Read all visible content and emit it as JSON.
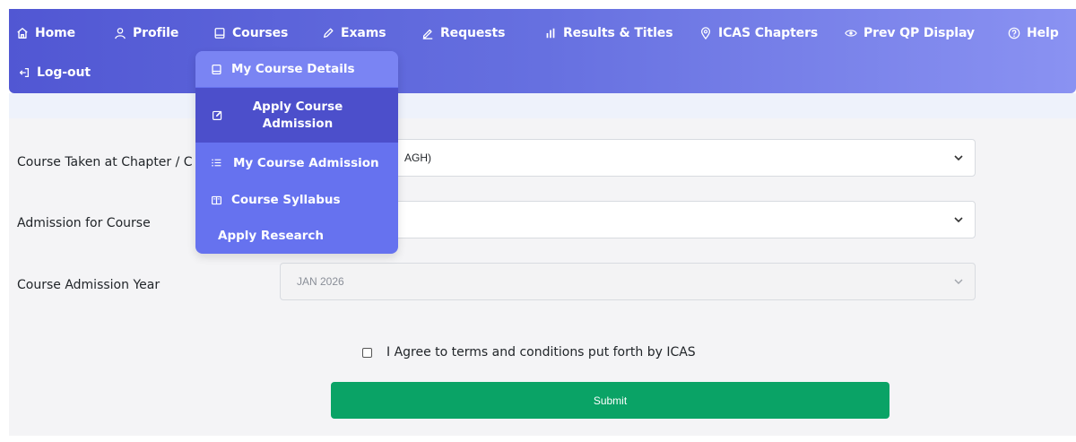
{
  "nav": {
    "items": [
      {
        "label": "Home",
        "icon": "home-icon"
      },
      {
        "label": "Profile",
        "icon": "user-icon"
      },
      {
        "label": "Courses",
        "icon": "book-icon"
      },
      {
        "label": "Exams",
        "icon": "pencil-icon"
      },
      {
        "label": "Requests",
        "icon": "pen-icon"
      },
      {
        "label": "Results & Titles",
        "icon": "bar-chart-icon"
      },
      {
        "label": "ICAS Chapters",
        "icon": "location-pin-icon"
      },
      {
        "label": "Prev QP Display",
        "icon": "eye-icon"
      },
      {
        "label": "Help",
        "icon": "help-circle-icon"
      },
      {
        "label": "Log-out",
        "icon": "logout-icon"
      }
    ]
  },
  "courses_menu": {
    "items": [
      {
        "label": "My Course Details",
        "icon": "book-icon"
      },
      {
        "label": "Apply Course Admission",
        "icon": "edit-icon"
      },
      {
        "label": "My Course Admission",
        "icon": "list-icon"
      },
      {
        "label": "Course Syllabus",
        "icon": "open-book-icon"
      },
      {
        "label": "Apply Research",
        "icon": ""
      }
    ]
  },
  "form": {
    "chapter_label": "Course Taken at Chapter / C",
    "chapter_value": "AGH)",
    "course_label": "Admission for Course",
    "course_value": "",
    "year_label": "Course Admission Year",
    "year_value": "JAN 2026",
    "agree_text": "I Agree to terms and conditions put forth by ICAS",
    "submit_label": "Submit"
  },
  "colors": {
    "nav_gradient_start": "#5157d3",
    "nav_gradient_end": "#8a92f2",
    "dropdown_bg": "#6672ef",
    "dropdown_active": "#4c4fcb",
    "submit_bg": "#0aa366"
  }
}
